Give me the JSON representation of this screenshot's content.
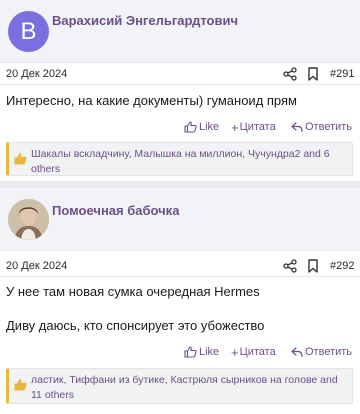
{
  "posts": [
    {
      "avatar_letter": "В",
      "username": "Варахисий Энгельгардтович",
      "date": "20 Дек 2024",
      "number": "#291",
      "text": [
        "Интересно, на какие документы) гуманоид прям"
      ],
      "actions": {
        "like": "Like",
        "quote": "Цитата",
        "reply": "Ответить"
      },
      "likes": "Шакалы вскладчину, Малышка на миллион, Чучундра2 and 6 others"
    },
    {
      "avatar_letter": "",
      "username": "Помоечная бабочка",
      "date": "20 Дек 2024",
      "number": "#292",
      "text": [
        "У нее там новая сумка очередная Hermes",
        "Диву даюсь, кто спонсирует это убожество"
      ],
      "actions": {
        "like": "Like",
        "quote": "Цитата",
        "reply": "Ответить"
      },
      "likes": "ластик, Тиффани из бутике, Кастрюля сырников на голове and 11 others"
    }
  ],
  "colors": {
    "accent": "#6c4f86",
    "avatar_bg": "#7d6ee0",
    "like_bar": "#e8b63a"
  }
}
